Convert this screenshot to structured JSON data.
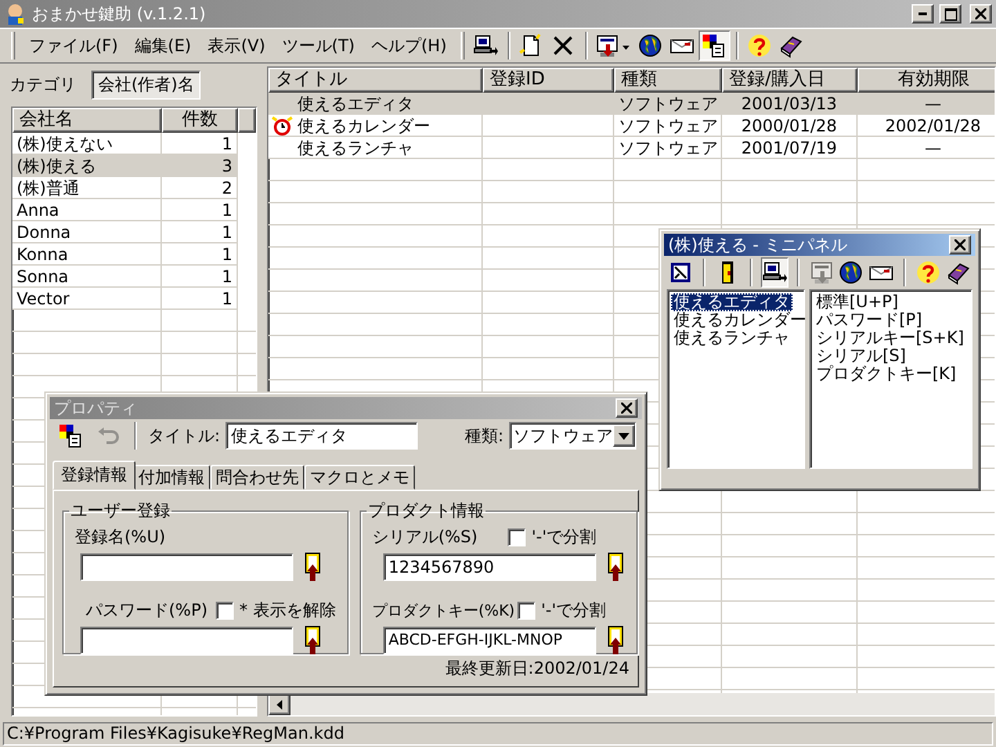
{
  "window": {
    "title": "おまかせ鍵助 (v.1.2.1)"
  },
  "menu": [
    "ファイル(F)",
    "編集(E)",
    "表示(V)",
    "ツール(T)",
    "ヘルプ(H)"
  ],
  "toolbar": [
    [
      {
        "kind": "import",
        "pressed": false
      }
    ],
    [
      {
        "kind": "new",
        "pressed": false
      },
      {
        "kind": "delete",
        "pressed": false
      }
    ],
    [
      {
        "kind": "export",
        "pressed": false
      },
      {
        "kind": "globe",
        "pressed": false
      },
      {
        "kind": "mail",
        "pressed": false
      },
      {
        "kind": "card",
        "pressed": true
      }
    ],
    [
      {
        "kind": "help",
        "pressed": false
      },
      {
        "kind": "book",
        "pressed": false
      }
    ]
  ],
  "left_tabs": [
    {
      "label": "カテゴリ",
      "selected": false
    },
    {
      "label": "会社(作者)名",
      "selected": true
    }
  ],
  "company_list": {
    "columns": [
      "会社名",
      "件数"
    ],
    "rows": [
      {
        "name": "(株)使えない",
        "count": "1",
        "selected": false
      },
      {
        "name": "(株)使える",
        "count": "3",
        "selected": true
      },
      {
        "name": "(株)普通",
        "count": "2",
        "selected": false
      },
      {
        "name": "Anna",
        "count": "1",
        "selected": false
      },
      {
        "name": "Donna",
        "count": "1",
        "selected": false
      },
      {
        "name": "Konna",
        "count": "1",
        "selected": false
      },
      {
        "name": "Sonna",
        "count": "1",
        "selected": false
      },
      {
        "name": "Vector",
        "count": "1",
        "selected": false
      }
    ]
  },
  "software_table": {
    "columns": [
      "タイトル",
      "登録ID",
      "種類",
      "登録/購入日",
      "有効期限"
    ],
    "rows": [
      {
        "title": "使えるエディタ",
        "type": "ソフトウェア",
        "date": "2001/03/13",
        "expiry": "—",
        "alarm": false,
        "selected": true
      },
      {
        "title": "使えるカレンダー",
        "type": "ソフトウェア",
        "date": "2000/01/28",
        "expiry": "2002/01/28",
        "alarm": true,
        "selected": false
      },
      {
        "title": "使えるランチャ",
        "type": "ソフトウェア",
        "date": "2001/07/19",
        "expiry": "—",
        "alarm": false,
        "selected": false
      }
    ]
  },
  "mini_panel": {
    "title": "(株)使える - ミニパネル",
    "toolbar": [
      [
        {
          "kind": "frame",
          "pressed": false,
          "disabled": false
        }
      ],
      [
        {
          "kind": "door",
          "pressed": false,
          "disabled": false
        }
      ],
      [
        {
          "kind": "import",
          "pressed": true,
          "disabled": false
        }
      ],
      [
        {
          "kind": "screen",
          "pressed": false,
          "disabled": true
        },
        {
          "kind": "globe",
          "pressed": false,
          "disabled": false
        },
        {
          "kind": "mail",
          "pressed": false,
          "disabled": false
        }
      ],
      [
        {
          "kind": "help",
          "pressed": false,
          "disabled": false
        },
        {
          "kind": "book",
          "pressed": false,
          "disabled": false
        }
      ]
    ],
    "software": [
      {
        "label": "使えるエディタ",
        "selected": true
      },
      {
        "label": "使えるカレンダー",
        "selected": false
      },
      {
        "label": "使えるランチャ",
        "selected": false
      }
    ],
    "key_formats": [
      "標準[U+P]",
      "パスワード[P]",
      "シリアルキー[S+K]",
      "シリアル[S]",
      "プロダクトキー[K]"
    ]
  },
  "properties": {
    "title": "プロパティ",
    "toolbar": [
      {
        "kind": "card",
        "disabled": false
      },
      {
        "kind": "undo",
        "disabled": true
      }
    ],
    "title_label": "タイトル:",
    "title_value": "使えるエディタ",
    "type_label": "種類:",
    "type_value": "ソフトウェア",
    "tabs": [
      {
        "label": "登録情報",
        "selected": true
      },
      {
        "label": "付加情報",
        "selected": false
      },
      {
        "label": "問合わせ先",
        "selected": false
      },
      {
        "label": "マクロとメモ",
        "selected": false
      }
    ],
    "user_group": {
      "legend": "ユーザー登録",
      "name_label": "登録名(%U)",
      "password_label": "パスワード(%P)",
      "unmask_label": "* 表示を解除",
      "unmask_checked": false
    },
    "product_group": {
      "legend": "プロダクト情報",
      "serial_label": "シリアル(%S)",
      "serial_split_label": "'-'で分割",
      "serial_split_checked": false,
      "serial_value": "1234567890",
      "key_label": "プロダクトキー(%K)",
      "key_split_label": "'-'で分割",
      "key_split_checked": false,
      "key_value": "ABCD-EFGH-IJKL-MNOP"
    },
    "last_updated": "最終更新日:2002/01/24"
  },
  "status_bar": {
    "path": "C:¥Program Files¥Kagisuke¥RegMan.kdd"
  }
}
